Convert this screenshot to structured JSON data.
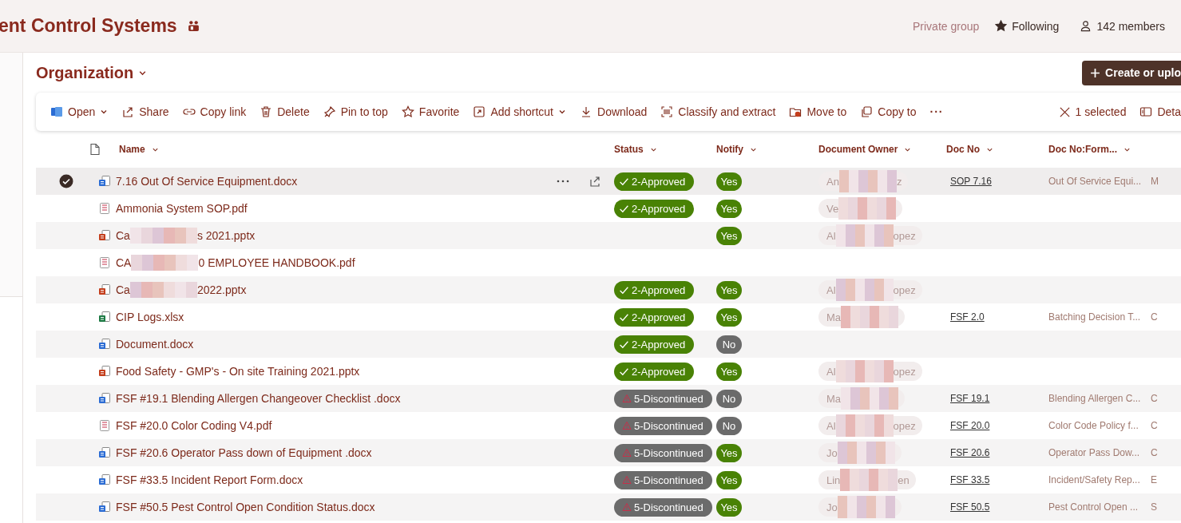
{
  "header": {
    "site_title": "ent Control Systems",
    "privacy": "Private group",
    "follow": {
      "label": "Following",
      "on": true
    },
    "members": "142 members"
  },
  "library": {
    "title": "Organization",
    "create_button": "Create or uplo"
  },
  "toolbar": {
    "items": [
      {
        "label": "Open",
        "dropdown": true
      },
      {
        "label": "Share",
        "dropdown": false
      },
      {
        "label": "Copy link",
        "dropdown": false
      },
      {
        "label": "Delete",
        "dropdown": false
      },
      {
        "label": "Pin to top",
        "dropdown": false
      },
      {
        "label": "Favorite",
        "dropdown": false
      },
      {
        "label": "Add shortcut",
        "dropdown": true
      },
      {
        "label": "Download",
        "dropdown": false
      },
      {
        "label": "Classify and extract",
        "dropdown": false
      },
      {
        "label": "Move to",
        "dropdown": false
      },
      {
        "label": "Copy to",
        "dropdown": false
      }
    ],
    "more": "···",
    "selection": "1 selected",
    "details": "Deta"
  },
  "table": {
    "columns": [
      "Name",
      "Status",
      "Notify",
      "Document Owner",
      "Doc No",
      "Doc No:Form..."
    ],
    "rows": [
      {
        "selected": true,
        "kind": "word",
        "name": {
          "prefix": "7.16 Out Of Service Equipment.docx"
        },
        "status": {
          "kind": "approved",
          "label": "2-Approved"
        },
        "notify": {
          "label": "Yes",
          "on": true
        },
        "owner": {
          "prefix": "An",
          "suffix": "z"
        },
        "doc_no": "SOP 7.16",
        "doc_form": "Out Of Service Equi...",
        "column_8": "M"
      },
      {
        "selected": false,
        "kind": "pdf",
        "name": {
          "prefix": "Ammonia System SOP.pdf"
        },
        "status": {
          "kind": "approved",
          "label": "2-Approved"
        },
        "notify": {
          "label": "Yes",
          "on": true
        },
        "owner": {
          "prefix": "Ve"
        }
      },
      {
        "selected": false,
        "kind": "powerpoint",
        "name": {
          "prefix": "Ca",
          "suffix": "s 2021.pptx"
        },
        "notify": {
          "label": "Yes",
          "on": true
        },
        "owner": {
          "prefix": "Al",
          "suffix": "opez"
        }
      },
      {
        "selected": false,
        "kind": "pdf",
        "name": {
          "prefix": "CA",
          "suffix": "0 EMPLOYEE HANDBOOK.pdf"
        }
      },
      {
        "selected": false,
        "kind": "powerpoint",
        "name": {
          "prefix": "Ca",
          "suffix": "2022.pptx"
        },
        "status": {
          "kind": "approved",
          "label": "2-Approved"
        },
        "notify": {
          "label": "Yes",
          "on": true
        },
        "owner": {
          "prefix": "Al",
          "suffix": "opez"
        }
      },
      {
        "selected": false,
        "kind": "excel",
        "name": {
          "prefix": "CIP Logs.xlsx"
        },
        "status": {
          "kind": "approved",
          "label": "2-Approved"
        },
        "notify": {
          "label": "Yes",
          "on": true
        },
        "owner": {
          "prefix": "Ma"
        },
        "doc_no": "FSF 2.0",
        "doc_form": "Batching Decision T...",
        "column_8": "C"
      },
      {
        "selected": false,
        "kind": "word",
        "name": {
          "prefix": "Document.docx"
        },
        "status": {
          "kind": "approved",
          "label": "2-Approved"
        },
        "notify": {
          "label": "No",
          "on": false
        }
      },
      {
        "selected": false,
        "kind": "powerpoint",
        "name": {
          "prefix": "Food Safety - GMP's - On site Training 2021.pptx"
        },
        "status": {
          "kind": "approved",
          "label": "2-Approved"
        },
        "notify": {
          "label": "Yes",
          "on": true
        },
        "owner": {
          "prefix": "Al",
          "suffix": "opez"
        }
      },
      {
        "selected": false,
        "kind": "word",
        "name": {
          "prefix": "FSF #19.1 Blending Allergen Changeover Checklist .docx"
        },
        "status": {
          "kind": "discontinued",
          "label": "5-Discontinued"
        },
        "notify": {
          "label": "No",
          "on": false
        },
        "owner": {
          "prefix": "Ma"
        },
        "doc_no": "FSF 19.1",
        "doc_form": "Blending Allergen C...",
        "column_8": "C"
      },
      {
        "selected": false,
        "kind": "pdf",
        "name": {
          "prefix": "FSF #20.0 Color Coding V4.pdf"
        },
        "status": {
          "kind": "discontinued",
          "label": "5-Discontinued"
        },
        "notify": {
          "label": "No",
          "on": false
        },
        "owner": {
          "prefix": "Al",
          "suffix": "opez"
        },
        "doc_no": "FSF 20.0",
        "doc_form": "Color Code Policy f...",
        "column_8": "C"
      },
      {
        "selected": false,
        "kind": "word",
        "name": {
          "prefix": "FSF #20.6 Operator Pass down of Equipment .docx"
        },
        "status": {
          "kind": "discontinued",
          "label": "5-Discontinued"
        },
        "notify": {
          "label": "Yes",
          "on": true
        },
        "owner": {
          "prefix": "Jo"
        },
        "doc_no": "FSF 20.6",
        "doc_form": "Operator Pass Dow...",
        "column_8": "C"
      },
      {
        "selected": false,
        "kind": "word",
        "name": {
          "prefix": "FSF #33.5 Incident Report Form.docx"
        },
        "status": {
          "kind": "discontinued",
          "label": "5-Discontinued"
        },
        "notify": {
          "label": "Yes",
          "on": true
        },
        "owner": {
          "prefix": "Lin",
          "suffix": "en"
        },
        "doc_no": "FSF 33.5",
        "doc_form": "Incident/Safety Rep...",
        "column_8": "E"
      },
      {
        "selected": false,
        "kind": "word",
        "name": {
          "prefix": "FSF #50.5 Pest Control Open Condition Status.docx"
        },
        "status": {
          "kind": "discontinued",
          "label": "5-Discontinued"
        },
        "notify": {
          "label": "Yes",
          "on": true
        },
        "owner": {
          "prefix": "Jo"
        },
        "doc_no": "FSF 50.5",
        "doc_form": "Pest Control Open ...",
        "column_8": "S"
      }
    ]
  }
}
